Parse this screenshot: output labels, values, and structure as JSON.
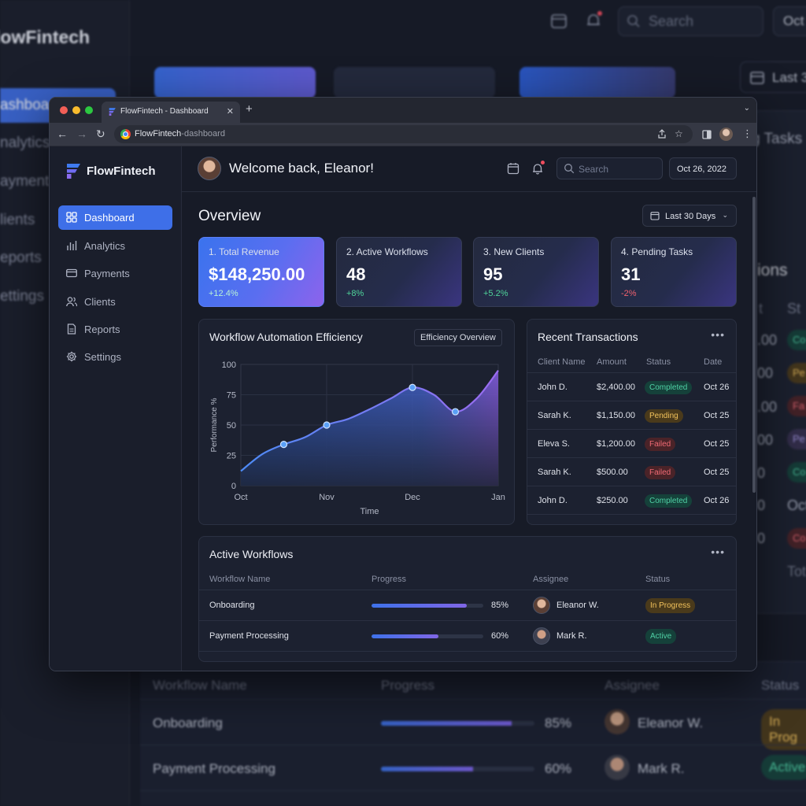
{
  "background_app": {
    "brand": "lowFintech",
    "nav": [
      "ashboa",
      "nalytics",
      "ayment",
      "lients",
      "eports",
      "ettings"
    ],
    "search_placeholder": "Search",
    "date": "Oct",
    "range": "Last 3",
    "side_fragments": [
      "g Tasks",
      "ions",
      "St",
      "t",
      ".00",
      "00",
      ".00",
      "00",
      "0",
      "0",
      "0",
      "Oct",
      "Tot"
    ],
    "badges": [
      "Co",
      "Pe",
      "Fa",
      "Pe",
      "Co",
      "Co"
    ],
    "table": {
      "headers": [
        "Workflow Name",
        "Progress",
        "Assignee",
        "Status"
      ],
      "rows": [
        {
          "name": "Onboarding",
          "progress_pct": 85,
          "progress_label": "85%",
          "assignee": "Eleanor W.",
          "status": "In Prog"
        },
        {
          "name": "Payment Processing",
          "progress_pct": 60,
          "progress_label": "60%",
          "assignee": "Mark R.",
          "status": "Active"
        }
      ]
    }
  },
  "browser": {
    "tab_title": "FlowFintech - Dashboard",
    "url_host": "FlowFintech",
    "url_path": "-dashboard",
    "icons": [
      "back-icon",
      "forward-icon",
      "reload-icon",
      "share-icon",
      "star-icon",
      "sidepanel-icon",
      "profile-icon",
      "menu-icon"
    ]
  },
  "app": {
    "brand": "FlowFintech",
    "nav": [
      {
        "label": "Dashboard",
        "icon": "grid-icon",
        "active": true
      },
      {
        "label": "Analytics",
        "icon": "bar-chart-icon",
        "active": false
      },
      {
        "label": "Payments",
        "icon": "credit-card-icon",
        "active": false
      },
      {
        "label": "Clients",
        "icon": "users-icon",
        "active": false
      },
      {
        "label": "Reports",
        "icon": "document-icon",
        "active": false
      },
      {
        "label": "Settings",
        "icon": "gear-icon",
        "active": false
      }
    ],
    "header": {
      "welcome": "Welcome back, Eleanor!",
      "search_placeholder": "Search",
      "date": "Oct 26, 2022"
    },
    "overview": {
      "title": "Overview",
      "range": "Last 30 Days"
    },
    "kpis": [
      {
        "label": "1. Total Revenue",
        "value": "$148,250.00",
        "change": "+12.4%",
        "trend": "up"
      },
      {
        "label": "2. Active Workflows",
        "value": "48",
        "change": "+8%",
        "trend": "up"
      },
      {
        "label": "3. New Clients",
        "value": "95",
        "change": "+5.2%",
        "trend": "up"
      },
      {
        "label": "4. Pending Tasks",
        "value": "31",
        "change": "-2%",
        "trend": "down"
      }
    ],
    "efficiency": {
      "title": "Workflow Automation Efficiency",
      "chip": "Efficiency Overview"
    },
    "transactions": {
      "title": "Recent Transactions",
      "headers": [
        "Client Name",
        "Amount",
        "Status",
        "Date"
      ],
      "rows": [
        {
          "client": "John D.",
          "amount": "$2,400.00",
          "status": "Completed",
          "date": "Oct 26"
        },
        {
          "client": "Sarah K.",
          "amount": "$1,150.00",
          "status": "Pending",
          "date": "Oct 25"
        },
        {
          "client": "Eleva S.",
          "amount": "$1,200.00",
          "status": "Failed",
          "date": "Oct 25"
        },
        {
          "client": "Sarah K.",
          "amount": "$500.00",
          "status": "Failed",
          "date": "Oct 25"
        },
        {
          "client": "John D.",
          "amount": "$250.00",
          "status": "Completed",
          "date": "Oct 26"
        }
      ]
    },
    "workflows": {
      "title": "Active Workflows",
      "headers": [
        "Workflow Name",
        "Progress",
        "Assignee",
        "Status"
      ],
      "rows": [
        {
          "name": "Onboarding",
          "progress_pct": 85,
          "progress_label": "85%",
          "assignee": "Eleanor W.",
          "status": "In Progress"
        },
        {
          "name": "Payment Processing",
          "progress_pct": 60,
          "progress_label": "60%",
          "assignee": "Mark R.",
          "status": "Active"
        }
      ]
    },
    "status_colors": {
      "Completed": {
        "bg": "#15413a",
        "fg": "#4fd1a5"
      },
      "Pending": {
        "bg": "#4a3a1b",
        "fg": "#f2c25b"
      },
      "Failed": {
        "bg": "#4a2328",
        "fg": "#f06a74"
      },
      "In Progress": {
        "bg": "#4a3a1b",
        "fg": "#f2c25b"
      },
      "Active": {
        "bg": "#15413a",
        "fg": "#4fd1a5"
      }
    },
    "colors": {
      "accent": "#3e6fe8",
      "positive": "#4fd49a",
      "negative": "#f0616e"
    }
  },
  "chart_data": {
    "type": "area",
    "title": "Workflow Automation Efficiency",
    "xlabel": "Time",
    "ylabel": "Performance %",
    "x_ticks": [
      "Oct",
      "Nov",
      "Dec",
      "Jan"
    ],
    "y_ticks": [
      0,
      25,
      50,
      75,
      100
    ],
    "ylim": [
      0,
      100
    ],
    "xlim": [
      0,
      3
    ],
    "grid": true,
    "points": [
      {
        "x": 0,
        "y": 12
      },
      {
        "x": 0.25,
        "y": 26
      },
      {
        "x": 0.5,
        "y": 34
      },
      {
        "x": 0.75,
        "y": 40
      },
      {
        "x": 1,
        "y": 50
      },
      {
        "x": 1.25,
        "y": 55
      },
      {
        "x": 1.5,
        "y": 63
      },
      {
        "x": 1.75,
        "y": 72
      },
      {
        "x": 2,
        "y": 81
      },
      {
        "x": 2.25,
        "y": 75
      },
      {
        "x": 2.5,
        "y": 61
      },
      {
        "x": 2.75,
        "y": 72
      },
      {
        "x": 3,
        "y": 95
      }
    ],
    "markers": [
      {
        "x": 0.5,
        "y": 34
      },
      {
        "x": 1,
        "y": 50
      },
      {
        "x": 2,
        "y": 81
      },
      {
        "x": 2.5,
        "y": 61
      }
    ]
  }
}
